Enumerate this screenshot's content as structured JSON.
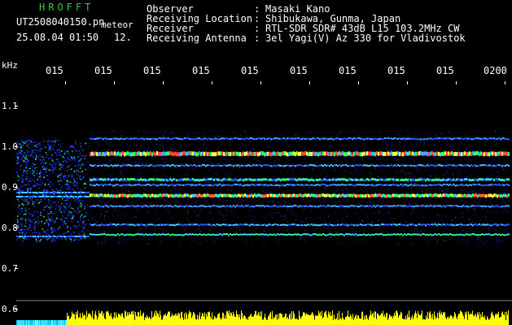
{
  "header": {
    "app_title": "HROFFT",
    "filename": "UT2508040150.pn",
    "filename_suffix": "meteor",
    "datetime": "25.08.04 01:50",
    "extra": "12.",
    "info": [
      {
        "label": "Observer",
        "value": "Masaki Kano"
      },
      {
        "label": "Receiving Location",
        "value": "Shibukawa, Gunma, Japan"
      },
      {
        "label": "Receiver",
        "value": "RTL-SDR SDR# 43dB L15 103.2MHz CW"
      },
      {
        "label": "Receiving Antenna",
        "value": "3el Yagi(V) Az 330 for Vladivostok"
      }
    ]
  },
  "axes": {
    "freq_unit": "kHz",
    "freq_ticks": [
      "1.1",
      "1.0",
      "0.9",
      "0.8",
      "0.7",
      "0.6"
    ],
    "time_ticks": [
      "015",
      "015",
      "015",
      "015",
      "015",
      "015",
      "015",
      "015",
      "015",
      "0200"
    ]
  },
  "colors": {
    "background": "#000000",
    "signal": "#ffff00",
    "title": "#33cc33"
  }
}
